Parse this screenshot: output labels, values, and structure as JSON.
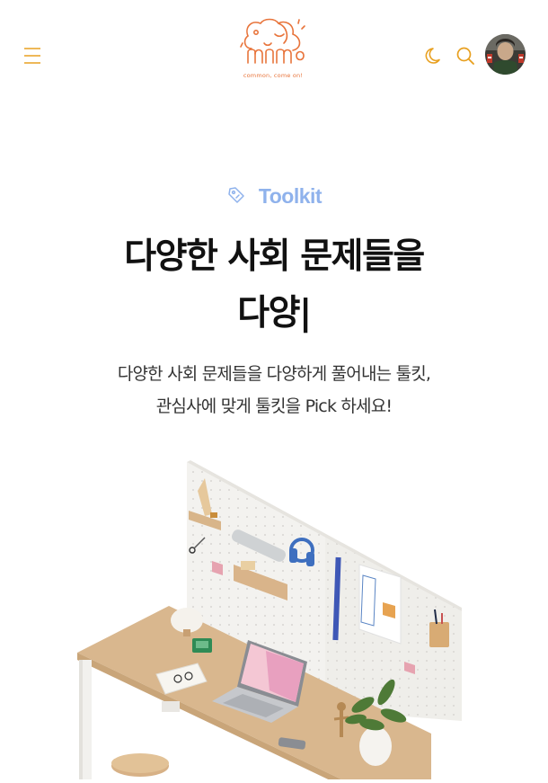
{
  "header": {
    "menu_icon": "hamburger-menu-icon",
    "logo_tagline": "common, come on!",
    "theme_icon": "moon-icon",
    "search_icon": "search-icon",
    "avatar_icon": "user-avatar"
  },
  "hero": {
    "eyebrow_icon": "pencil-tag-icon",
    "eyebrow": "Toolkit",
    "headline_line1": "다양한 사회 문제들을",
    "headline_line2": "다양|",
    "subtitle_line1": "다양한 사회 문제들을 다양하게 풀어내는 툴킷,",
    "subtitle_line2": "관심사에 맞게 툴킷을 Pick 하세요!"
  },
  "colors": {
    "accent_orange": "#e8a020",
    "eyebrow_blue": "#8fb2ec",
    "logo_orange": "#e8743b",
    "headline": "#111111"
  },
  "illustration": "desk-workspace-illustration"
}
